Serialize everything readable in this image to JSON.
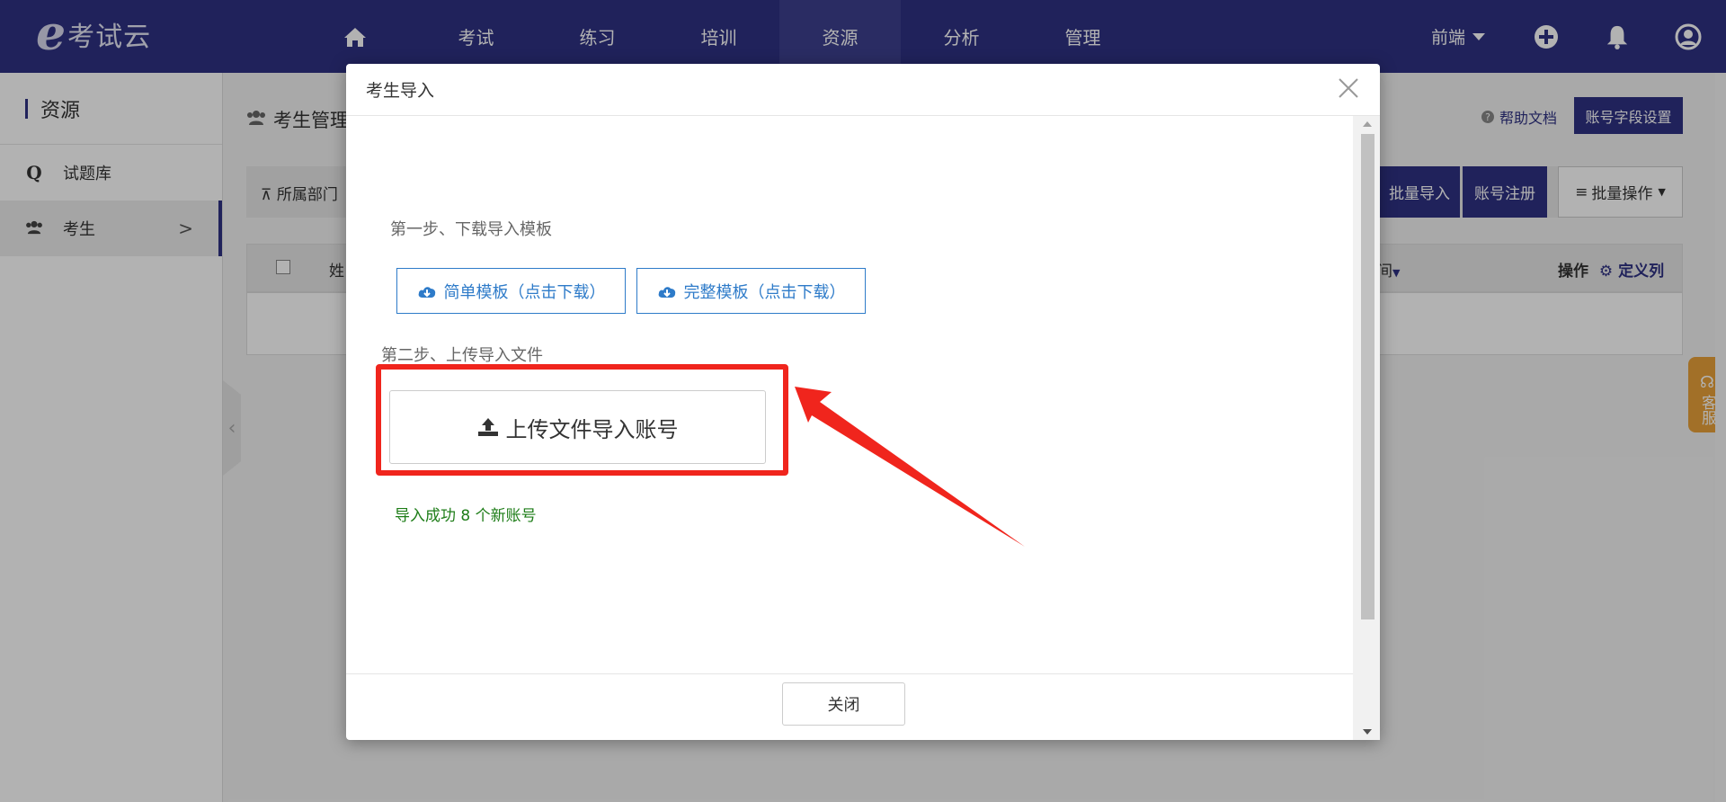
{
  "brand": {
    "mark": "e",
    "name": "考试云"
  },
  "nav": {
    "items": [
      {
        "icon": "home-icon",
        "label": ""
      },
      {
        "label": "考试"
      },
      {
        "label": "练习"
      },
      {
        "label": "培训"
      },
      {
        "label": "资源"
      },
      {
        "label": "分析"
      },
      {
        "label": "管理"
      }
    ],
    "active_index": 4,
    "org_label": "前端"
  },
  "sidebar": {
    "title": "资源",
    "items": [
      {
        "icon": "Q",
        "label": "试题库"
      },
      {
        "icon": "users-icon",
        "label": "考生",
        "chevron": ">"
      }
    ]
  },
  "main": {
    "title": "考生管理",
    "help_label": "帮助文档",
    "field_settings_label": "账号字段设置",
    "dept_filter_label": "所属部门",
    "batch_import_label": "批量导入",
    "register_label": "账号注册",
    "batch_ops_label": "批量操作",
    "table": {
      "col_name": "姓",
      "col_time": "间",
      "col_ops": "操作",
      "define_cols": "定义列"
    },
    "support_tab_label": "客服"
  },
  "modal": {
    "title": "考生导入",
    "step1": "第一步、下载导入模板",
    "simple_template": "简单模板（点击下载）",
    "full_template": "完整模板（点击下载）",
    "step2": "第二步、上传导入文件",
    "upload_label": "上传文件导入账号",
    "success_message": "导入成功 8 个新账号",
    "close_label": "关闭"
  },
  "colors": {
    "nav_bg": "#2f3183",
    "accent_blue": "#2e7bc9",
    "highlight_red": "#f0251d",
    "success_green": "#1e7d18",
    "support_orange": "#e8a13a"
  }
}
